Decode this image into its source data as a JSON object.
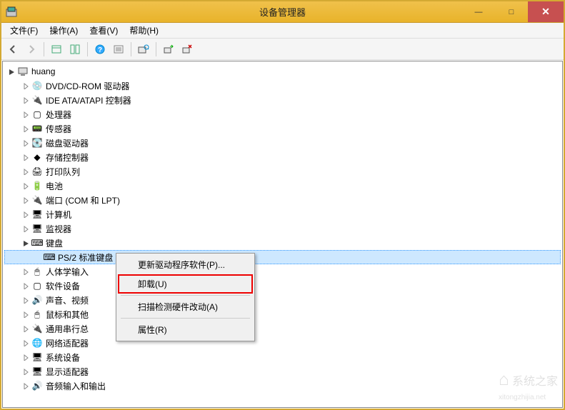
{
  "window": {
    "title": "设备管理器",
    "min": "—",
    "max": "□",
    "close": "✕"
  },
  "menu": {
    "file": "文件(F)",
    "action": "操作(A)",
    "view": "查看(V)",
    "help": "帮助(H)"
  },
  "tree": {
    "root": "huang",
    "items": [
      {
        "label": "DVD/CD-ROM 驱动器",
        "icon": "💿"
      },
      {
        "label": "IDE ATA/ATAPI 控制器",
        "icon": "🔌"
      },
      {
        "label": "处理器",
        "icon": "▢"
      },
      {
        "label": "传感器",
        "icon": "📟"
      },
      {
        "label": "磁盘驱动器",
        "icon": "💽"
      },
      {
        "label": "存储控制器",
        "icon": "◆"
      },
      {
        "label": "打印队列",
        "icon": "🖨"
      },
      {
        "label": "电池",
        "icon": "🔋"
      },
      {
        "label": "端口 (COM 和 LPT)",
        "icon": "🔌"
      },
      {
        "label": "计算机",
        "icon": "🖥"
      },
      {
        "label": "监视器",
        "icon": "🖥"
      },
      {
        "label": "键盘",
        "icon": "⌨",
        "expanded": true,
        "children": [
          {
            "label": "PS/2 标准键盘",
            "icon": "⌨",
            "selected": true
          }
        ]
      },
      {
        "label": "人体学输入",
        "icon": "🖱"
      },
      {
        "label": "软件设备",
        "icon": "▢"
      },
      {
        "label": "声音、视频",
        "icon": "🔊"
      },
      {
        "label": "鼠标和其他",
        "icon": "🖱"
      },
      {
        "label": "通用串行总",
        "icon": "🔌"
      },
      {
        "label": "网络适配器",
        "icon": "🌐"
      },
      {
        "label": "系统设备",
        "icon": "🖥"
      },
      {
        "label": "显示适配器",
        "icon": "🖥"
      },
      {
        "label": "音频输入和输出",
        "icon": "🔊"
      }
    ]
  },
  "context_menu": {
    "update_driver": "更新驱动程序软件(P)...",
    "uninstall": "卸载(U)",
    "scan_hardware": "扫描检测硬件改动(A)",
    "properties": "属性(R)"
  },
  "watermark": {
    "text": "系统之家",
    "url": "xitongzhijia.net"
  }
}
